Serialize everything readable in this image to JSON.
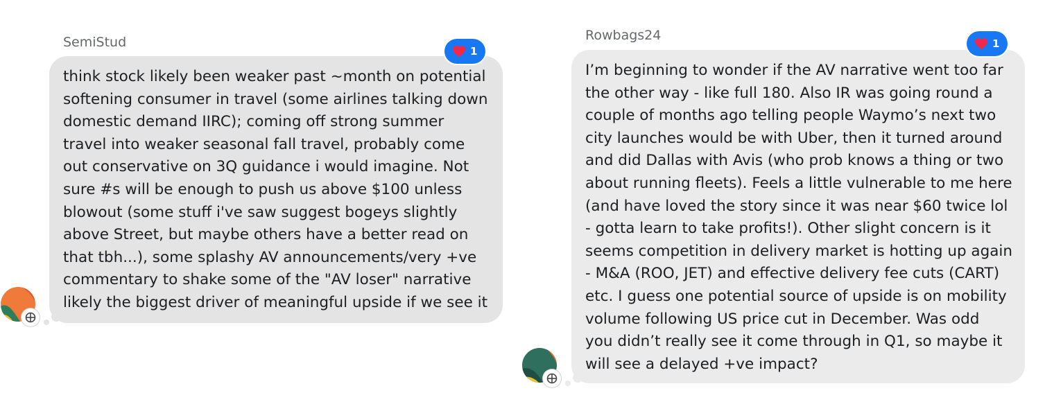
{
  "messages": [
    {
      "author": "SemiStud",
      "reaction_count": "1",
      "reaction_icon": "heart-icon",
      "lines": [
        "think stock likely been weaker past ~month on potential",
        "softening consumer in travel (some airlines talking down",
        "domestic demand IIRC); coming off strong summer",
        "travel into weaker seasonal fall travel, probably come",
        "out conservative on 3Q guidance i would imagine. Not",
        "sure #s will be enough to push us above $100 unless",
        "blowout (some stuff i've saw suggest bogeys slightly",
        "above Street, but maybe others have a better read on",
        "that tbh...), some splashy AV announcements/very +ve",
        "commentary to shake some of the \"AV loser\" narrative",
        "likely the biggest driver of meaningful upside if we see it"
      ]
    },
    {
      "author": "Rowbags24",
      "reaction_count": "1",
      "reaction_icon": "heart-icon",
      "lines": [
        "I’m beginning to wonder if the AV narrative went too far",
        "the other way - like full 180. Also IR was going round a",
        "couple of months ago telling people Waymo’s next two",
        "city launches would be with Uber, then it turned around",
        "and did Dallas with Avis (who prob knows a thing or two",
        "about running fleets). Feels a little vulnerable to me here",
        "(and have loved the story since it was near $60 twice lol",
        "- gotta learn to take profits!). Other slight concern is it",
        "seems competition in delivery market is hotting up again",
        "- M&A (ROO, JET) and effective delivery fee cuts (CART)",
        "etc. I guess one potential source of upside is on mobility",
        "volume following US price cut in December. Was odd",
        "you didn’t really see it come through in Q1, so maybe it",
        "will see a delayed +ve impact?"
      ]
    }
  ],
  "colors": {
    "bubble": "#e4e4e4",
    "reaction_badge": "#1877f2",
    "heart": "#f0284a",
    "author_text": "#65676b"
  }
}
